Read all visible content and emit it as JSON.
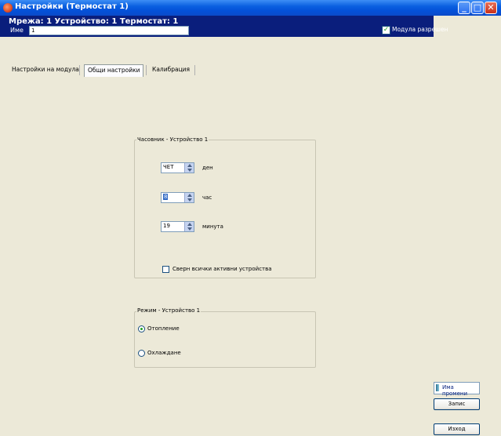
{
  "window": {
    "title": "Настройки (Термостат 1)",
    "controls": {
      "minimize": "_",
      "maximize": "□",
      "close": "✕"
    }
  },
  "header": {
    "info": "Мрежа: 1  Устройство: 1  Термостат: 1",
    "name_label": "Име",
    "name_value": "1",
    "module_enabled_label": "Модула разрешен",
    "module_enabled_checked": true
  },
  "tabs": [
    {
      "label": "Настройки на модула",
      "active": false
    },
    {
      "label": "Общи настройки",
      "active": true
    },
    {
      "label": "Калибрация",
      "active": false
    }
  ],
  "clock_group": {
    "title": "Часовник - Устройство 1",
    "day_value": "ЧЕТ",
    "day_label": "ден",
    "hour_value": "8",
    "hour_label": "час",
    "minute_value": "19",
    "minute_label": "минута",
    "sync_label": "Сверн всички активни устройства",
    "sync_checked": false
  },
  "mode_group": {
    "title": "Режим - Устройство 1",
    "options": [
      {
        "label": "Отопление",
        "selected": true
      },
      {
        "label": "Охлаждане",
        "selected": false
      }
    ]
  },
  "buttons": {
    "changes": "Има промени",
    "save": "Запис",
    "exit": "Изход"
  },
  "colors": {
    "titlebar": "#0A5FE0",
    "header": "#0A1E7C",
    "window_bg": "#ECE9D8",
    "checkbox_check": "#21A121"
  }
}
